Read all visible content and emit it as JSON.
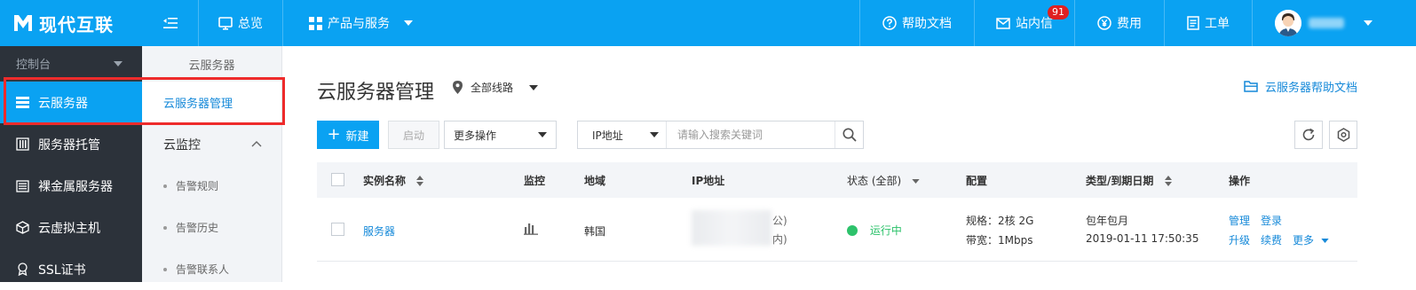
{
  "brand": {
    "name": "现代互联",
    "accent": "#0aa2f2"
  },
  "topbar": {
    "menu_toggle_icon": "menu-collapse-icon",
    "overview": "总览",
    "products": "产品与服务",
    "help_docs": "帮助文档",
    "messages": "站内信",
    "messages_badge": "91",
    "fees": "费用",
    "tickets": "工单"
  },
  "leftnav": {
    "console": "控制台",
    "items": [
      {
        "label": "云服务器",
        "icon": "server-icon",
        "active": true
      },
      {
        "label": "服务器托管",
        "icon": "server-rack-icon"
      },
      {
        "label": "裸金属服务器",
        "icon": "bare-metal-icon"
      },
      {
        "label": "云虚拟主机",
        "icon": "cube-icon"
      },
      {
        "label": "SSL证书",
        "icon": "certificate-icon"
      }
    ]
  },
  "subnav": {
    "title": "云服务器",
    "active_item": "云服务器管理",
    "group": "云监控",
    "sub_items": [
      "告警规则",
      "告警历史",
      "告警联系人"
    ]
  },
  "main": {
    "title": "云服务器管理",
    "region": "全部线路",
    "help_link": "云服务器帮助文档",
    "toolbar": {
      "new_label": "新建",
      "start_label": "启动",
      "more_ops": "更多操作",
      "search_type": "IP地址",
      "search_placeholder": "请输入搜索关键词"
    },
    "table": {
      "headers": {
        "name": "实例名称",
        "monitor": "监控",
        "region": "地域",
        "ip": "IP地址",
        "status": "状态 (全部)",
        "config": "配置",
        "type_expire": "类型/到期日期",
        "actions": "操作"
      },
      "rows": [
        {
          "name": "服务器",
          "region": "韩国",
          "ip_suffix_1": "公)",
          "ip_suffix_2": "内)",
          "status": "运行中",
          "spec": "规格：2核 2G",
          "bandwidth": "带宽：1Mbps",
          "billing": "包年包月",
          "expire": "2019-01-11 17:50:35",
          "actions": {
            "manage": "管理",
            "login": "登录",
            "upgrade": "升级",
            "renew": "续费",
            "more": "更多"
          }
        }
      ]
    }
  }
}
